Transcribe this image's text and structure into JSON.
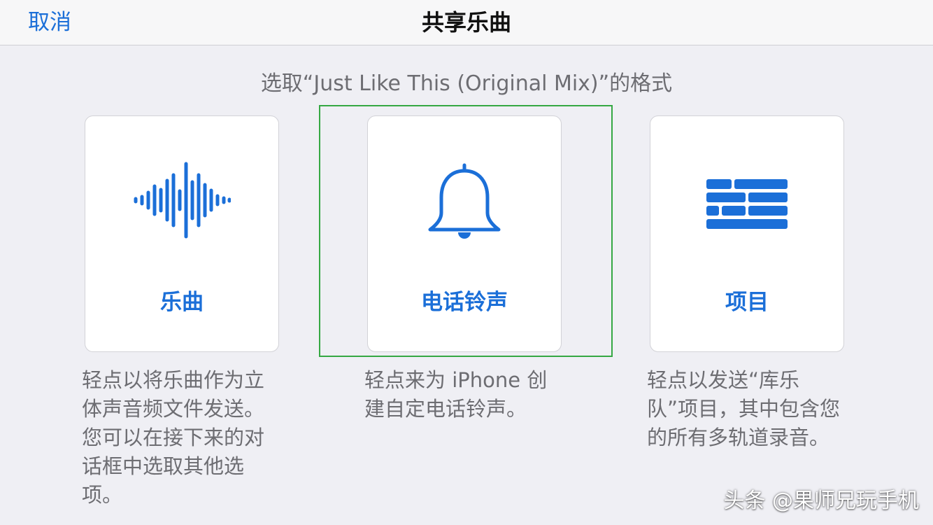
{
  "navbar": {
    "cancel_label": "取消",
    "title": "共享乐曲"
  },
  "prompt": "选取“Just Like This (Original Mix)”的格式",
  "options": [
    {
      "icon": "waveform-icon",
      "label": "乐曲",
      "description": "轻点以将乐曲作为立体声音频文件发送。您可以在接下来的对话框中选取其他选项。"
    },
    {
      "icon": "bell-icon",
      "label": "电话铃声",
      "description": "轻点来为 iPhone 创建自定电话铃声。"
    },
    {
      "icon": "brick-wall-icon",
      "label": "项目",
      "description": "轻点以发送“库乐队”项目，其中包含您的所有多轨道录音。"
    }
  ],
  "watermark": "头条 @果师兄玩手机",
  "colors": {
    "accent": "#1b6fd8",
    "background": "#efeff4",
    "selection_frame": "#35a843",
    "secondary_text": "#6d6d72"
  }
}
